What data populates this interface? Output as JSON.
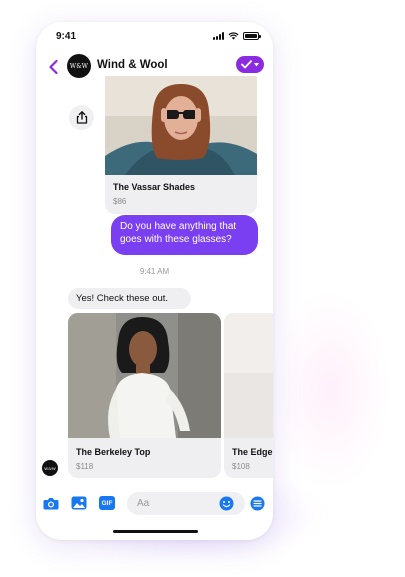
{
  "status_bar": {
    "time": "9:41"
  },
  "header": {
    "shop_name": "Wind & Wool",
    "logo_text": "W&W"
  },
  "products": [
    {
      "title": "The Vassar Shades",
      "price": "$86"
    },
    {
      "title": "The Berkeley Top",
      "price": "$118"
    },
    {
      "title": "The Edgerton Dress",
      "price": "$108"
    }
  ],
  "messages": {
    "outgoing": "Do you have anything that goes with these glasses?",
    "timestamp": "9:41 AM",
    "incoming": "Yes! Check these out."
  },
  "composer": {
    "placeholder": "Aa",
    "gif_label": "GIF"
  },
  "colors": {
    "accent": "#8a2be2",
    "bubble": "#7b3ff2",
    "icon_blue": "#1877f2"
  },
  "icons": [
    "back-chevron-icon",
    "check-icon",
    "share-icon",
    "camera-icon",
    "image-icon",
    "gif-icon",
    "emoji-icon",
    "menu-icon"
  ]
}
